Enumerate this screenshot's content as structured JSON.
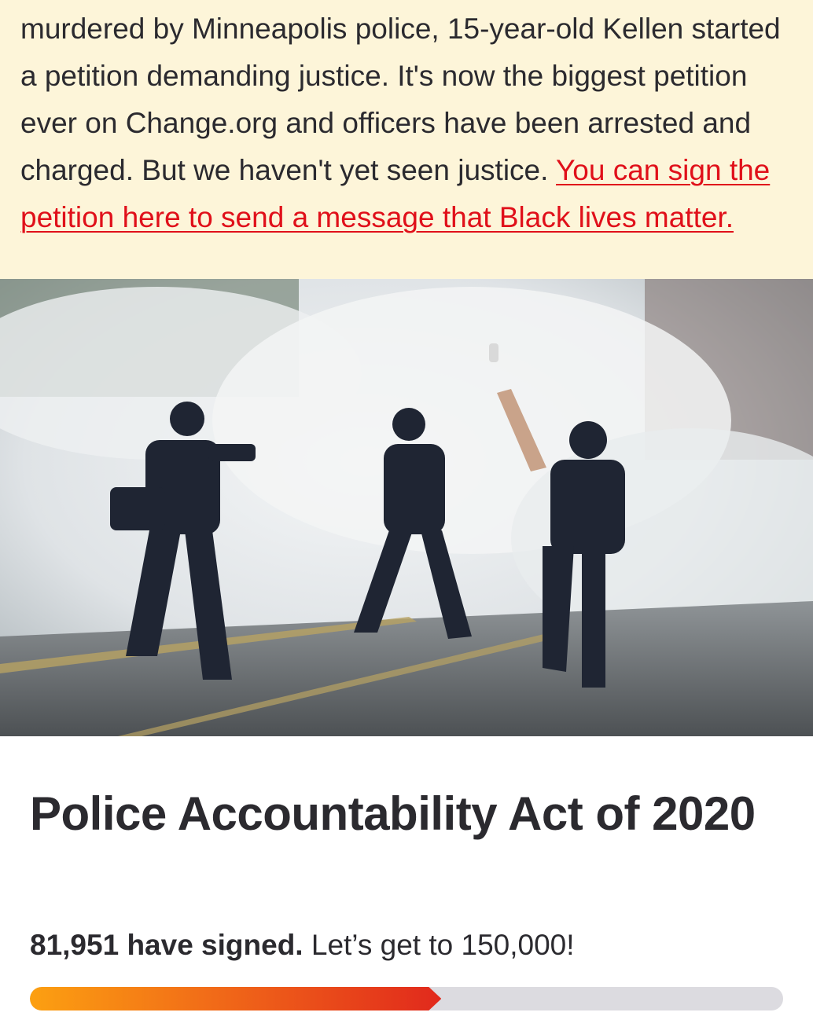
{
  "banner": {
    "text_before_link": "murdered by Minneapolis police, 15-year-old Kellen started a petition demanding justice. It's now the biggest petition ever on Change.org and officers have been arrested and charged. But we haven't yet seen justice. ",
    "link_text": "You can sign the petition here to send a message that Black lives matter.",
    "link_color": "#e0101a",
    "background_color": "#fdf5d9"
  },
  "photo": {
    "description_icon": "protest-photo"
  },
  "petition": {
    "title": "Police Accountability Act of 2020",
    "signed_count": "81,951 have signed.",
    "goal_text": " Let’s get to 150,000!",
    "progress_fraction": 0.5463
  },
  "colors": {
    "progress_start": "#fca011",
    "progress_end": "#e1291c",
    "track": "#dcdbe0",
    "text": "#2b2a2f"
  }
}
